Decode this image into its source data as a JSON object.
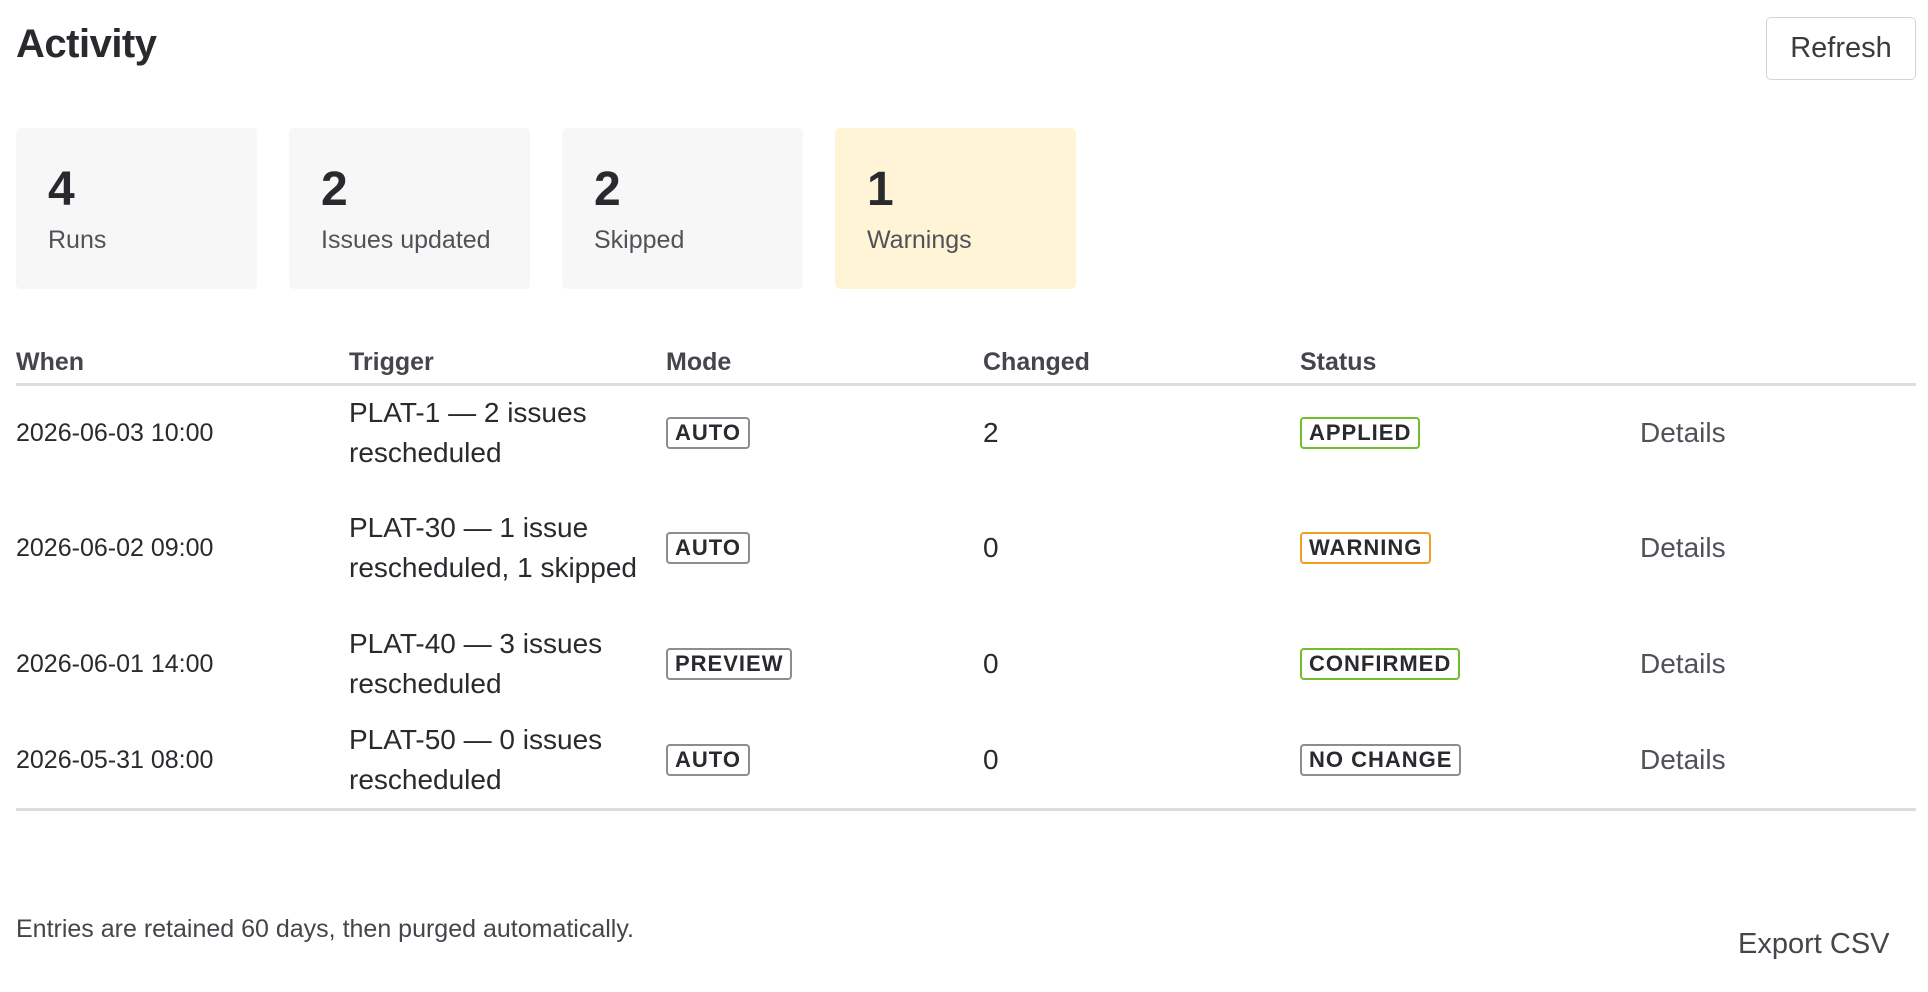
{
  "header": {
    "title": "Activity",
    "refresh_label": "Refresh"
  },
  "stats": [
    {
      "value": "4",
      "label": "Runs"
    },
    {
      "value": "2",
      "label": "Issues updated"
    },
    {
      "value": "2",
      "label": "Skipped"
    },
    {
      "value": "1",
      "label": "Warnings"
    }
  ],
  "table": {
    "columns": [
      "When",
      "Trigger",
      "Mode",
      "Changed",
      "Status"
    ],
    "rows": [
      {
        "when": "2026-06-03 10:00",
        "trigger": "PLAT-1 — 2 issues rescheduled",
        "mode": "AUTO",
        "changed": "2",
        "status": "APPLIED",
        "action": "Details"
      },
      {
        "when": "2026-06-02 09:00",
        "trigger": "PLAT-30 — 1 issue rescheduled, 1 skipped",
        "mode": "AUTO",
        "changed": "0",
        "status": "WARNING",
        "action": "Details"
      },
      {
        "when": "2026-06-01 14:00",
        "trigger": "PLAT-40 — 3 issues rescheduled",
        "mode": "PREVIEW",
        "changed": "0",
        "status": "CONFIRMED",
        "action": "Details"
      },
      {
        "when": "2026-05-31 08:00",
        "trigger": "PLAT-50 — 0 issues rescheduled",
        "mode": "AUTO",
        "changed": "0",
        "status": "NO CHANGE",
        "action": "Details"
      }
    ]
  },
  "footer": {
    "note": "Entries are retained 60 days, then purged automatically.",
    "export_label": "Export CSV"
  },
  "colors": {
    "applied": "#6fbf2a",
    "warning": "#f0a020",
    "neutral": "#8b8d93",
    "warning_card_bg": "#fff4d6"
  }
}
